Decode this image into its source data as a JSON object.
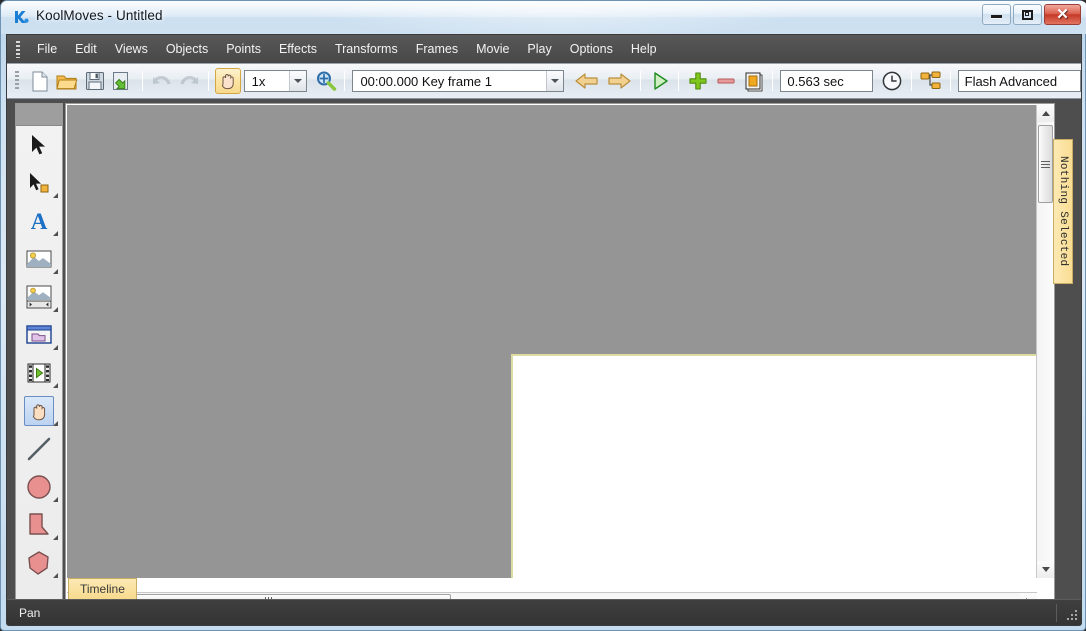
{
  "window": {
    "title": "KoolMoves - Untitled",
    "app_icon": "koolmoves-logo-icon",
    "controls": {
      "minimize": "Minimize",
      "maximize": "Maximize",
      "close": "Close"
    },
    "accent_close": "#c43a27",
    "accent_titlebar": "#c9def0"
  },
  "menubar": {
    "items": [
      {
        "label": "File"
      },
      {
        "label": "Edit"
      },
      {
        "label": "Views"
      },
      {
        "label": "Objects"
      },
      {
        "label": "Points"
      },
      {
        "label": "Effects"
      },
      {
        "label": "Transforms"
      },
      {
        "label": "Frames"
      },
      {
        "label": "Movie"
      },
      {
        "label": "Play"
      },
      {
        "label": "Options"
      },
      {
        "label": "Help"
      }
    ]
  },
  "toolbar": {
    "buttons": [
      {
        "name": "new-document-button",
        "icon": "new-document-icon",
        "enabled": true
      },
      {
        "name": "open-file-button",
        "icon": "open-folder-icon",
        "enabled": true
      },
      {
        "name": "save-button",
        "icon": "floppy-disk-icon",
        "enabled": true
      },
      {
        "name": "export-button",
        "icon": "export-arrow-icon",
        "enabled": true
      },
      {
        "name": "undo-button",
        "icon": "undo-arrow-icon",
        "enabled": false
      },
      {
        "name": "redo-button",
        "icon": "redo-arrow-icon",
        "enabled": false
      },
      {
        "name": "pan-tool-button",
        "icon": "hand-icon",
        "enabled": true,
        "active": true
      }
    ],
    "zoom_combo": {
      "value": "1x",
      "name": "zoom-level-combo"
    },
    "zoom_tool": {
      "name": "magnifier-button",
      "icon": "magnifier-icon"
    },
    "keyframe_combo": {
      "value": "00:00.000  Key frame 1",
      "name": "keyframe-combo"
    },
    "prev_frame": {
      "name": "previous-frame-button",
      "icon": "arrow-left-icon"
    },
    "next_frame": {
      "name": "next-frame-button",
      "icon": "arrow-right-icon"
    },
    "play": {
      "name": "play-button",
      "icon": "play-triangle-icon"
    },
    "add_frame": {
      "name": "add-frame-button",
      "icon": "plus-icon"
    },
    "remove_frame": {
      "name": "remove-frame-button",
      "icon": "minus-icon"
    },
    "frames_view": {
      "name": "frames-view-button",
      "icon": "filmstrip-pages-icon"
    },
    "duration_field": {
      "value": "0.563 sec",
      "name": "movie-duration-field"
    },
    "timing_button": {
      "name": "timing-button",
      "icon": "clock-icon"
    },
    "hierarchy_button": {
      "name": "hierarchy-button",
      "icon": "tree-hierarchy-icon"
    },
    "export_format_field": {
      "value": "Flash Advanced",
      "name": "export-format-field"
    }
  },
  "left_palette": {
    "tools": [
      {
        "name": "select-tool",
        "icon": "arrow-cursor-icon",
        "selected": false
      },
      {
        "name": "point-select-tool",
        "icon": "arrow-cursor-point-icon",
        "selected": false
      },
      {
        "name": "text-tool",
        "icon": "text-a-icon",
        "selected": false
      },
      {
        "name": "image-tool",
        "icon": "image-icon",
        "selected": false
      },
      {
        "name": "animated-image-tool",
        "icon": "image-sequence-icon",
        "selected": false
      },
      {
        "name": "window-tool",
        "icon": "window-folder-icon",
        "selected": false
      },
      {
        "name": "movie-clip-tool",
        "icon": "filmstrip-play-icon",
        "selected": false
      },
      {
        "name": "pan-tool",
        "icon": "hand-icon",
        "selected": true
      },
      {
        "name": "line-tool",
        "icon": "line-icon",
        "selected": false
      },
      {
        "name": "ellipse-tool",
        "icon": "circle-icon",
        "selected": false
      },
      {
        "name": "shape-tool",
        "icon": "quad-shape-icon",
        "selected": false
      },
      {
        "name": "polygon-tool",
        "icon": "polygon-icon",
        "selected": false
      }
    ]
  },
  "canvas": {
    "stage_background": "#ffffff",
    "workspace_background": "#959595",
    "stage_border": "#dcdba0"
  },
  "right_panel": {
    "tab_label": "Nothing Selected",
    "tab_name": "nothing-selected-tab"
  },
  "tabs": {
    "timeline": "Timeline"
  },
  "statusbar": {
    "text": "Pan"
  }
}
